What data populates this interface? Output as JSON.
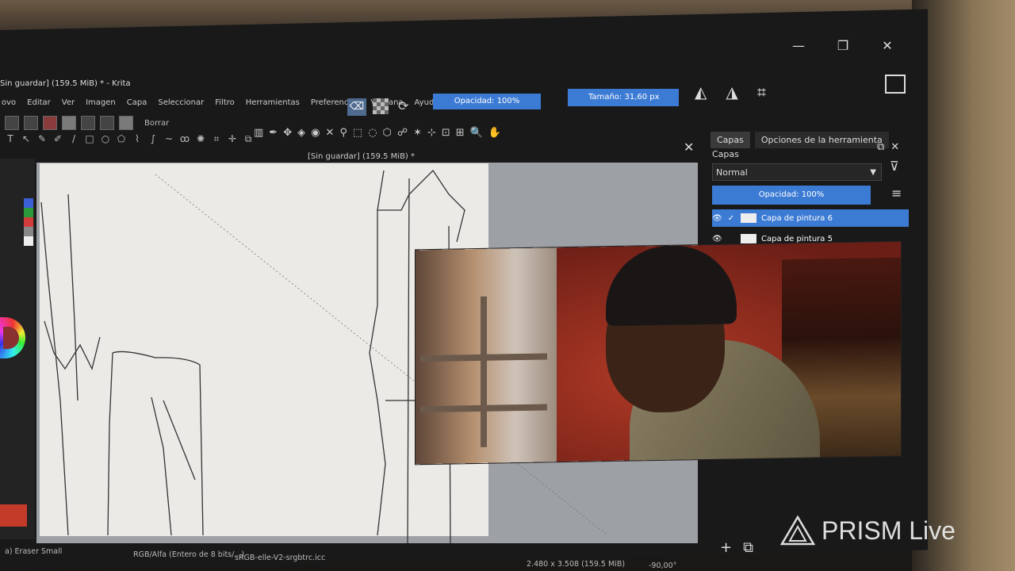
{
  "window": {
    "title": "Sin guardar] (159.5 MiB) * - Krita",
    "controls": [
      "minimize-icon",
      "restore-icon",
      "close-icon"
    ]
  },
  "menu": [
    "ovo",
    "Editar",
    "Ver",
    "Imagen",
    "Capa",
    "Seleccionar",
    "Filtro",
    "Herramientas",
    "Preferencias",
    "Ventana",
    "Ayuda"
  ],
  "toolbar": {
    "preset_label": "Borrar",
    "opacity": "Opacidad: 100%",
    "size": "Tamaño: 31,60 px"
  },
  "document": {
    "tab_title": "[Sin guardar] (159.5 MiB) *"
  },
  "dock": {
    "tabs": [
      "Capas",
      "Opciones de la herramienta"
    ],
    "title": "Capas",
    "blend_mode": "Normal",
    "opacity": "Opacidad:  100%",
    "layers": [
      {
        "name": "Capa de pintura 6",
        "active": true
      },
      {
        "name": "Capa de pintura 5",
        "active": false
      }
    ]
  },
  "status": {
    "tool": "a) Eraser Small",
    "color_space": "RGB/Alfa (Entero de 8 bits/...)",
    "profile": "sRGB-elle-V2-srgbtrc.icc",
    "dimensions": "2.480 x 3.508 (159.5 MiB)",
    "rotation": "-90,00°"
  },
  "watermark": {
    "brand": "PRISM Live"
  },
  "colors": {
    "accent": "#3c7bd4",
    "fg_swatch": "#c43b2a"
  }
}
